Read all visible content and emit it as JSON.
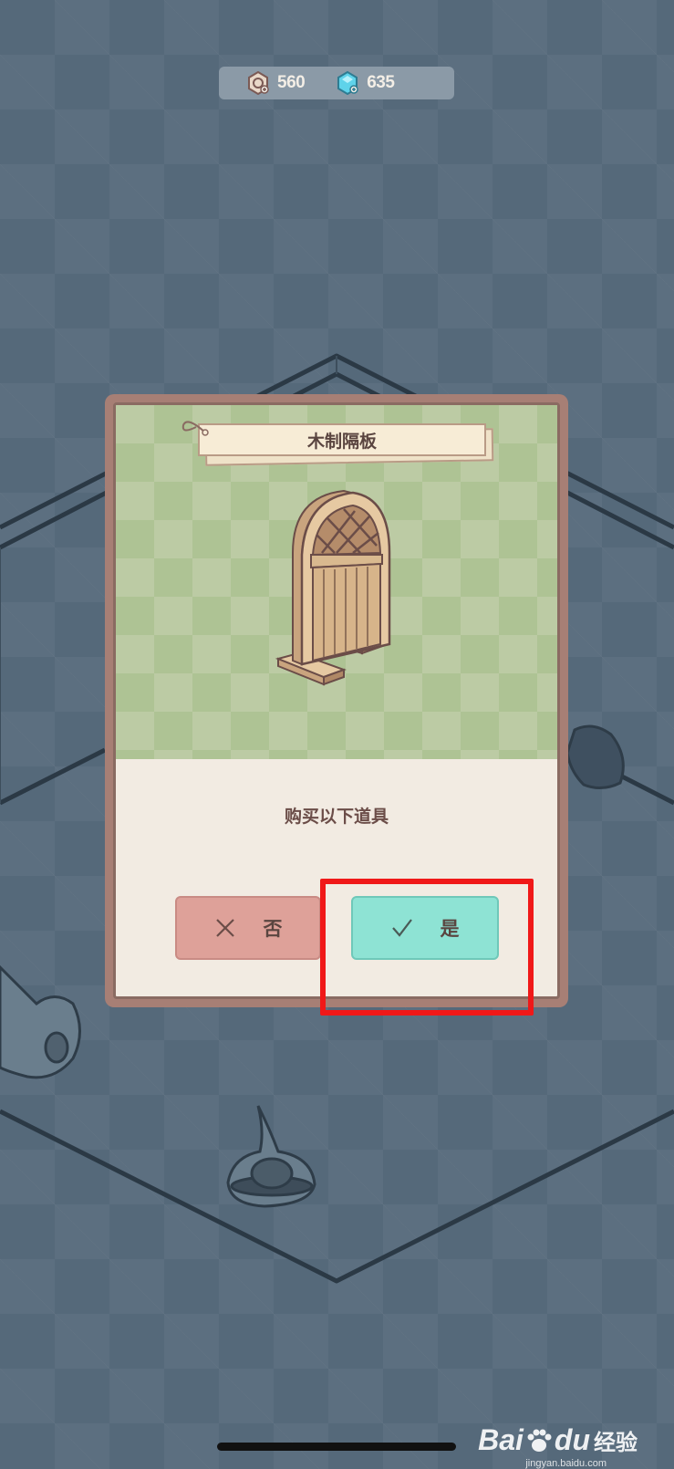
{
  "currencies": [
    {
      "name": "coin",
      "icon": "coin-icon",
      "amount": "560"
    },
    {
      "name": "gem",
      "icon": "gem-icon",
      "amount": "635"
    }
  ],
  "dialog": {
    "item_name": "木制隔板",
    "item_image": "wooden-divider",
    "prompt": "购买以下道具",
    "no_button": {
      "label": "否",
      "icon": "close-icon",
      "color": "#dea199"
    },
    "yes_button": {
      "label": "是",
      "icon": "check-icon",
      "color": "#8ee3d4"
    }
  },
  "annotation": {
    "type": "highlight-box",
    "target": "yes_button",
    "color": "#f01818"
  },
  "watermark": {
    "brand": "Bai",
    "brand_suffix": "du",
    "suffix": "经验",
    "url": "jingyan.baidu.com"
  }
}
